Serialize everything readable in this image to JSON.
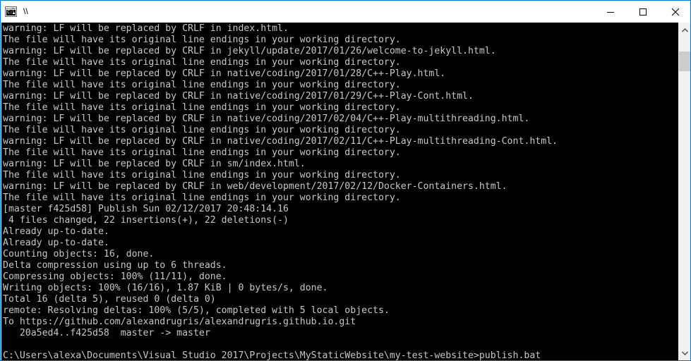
{
  "window": {
    "title": "\\\\",
    "icon": "cmd-console-icon",
    "icon_glyph": "C:\\",
    "accent_color": "#0078d7",
    "titlebar_background": "#ffffff",
    "console_background": "#000000",
    "console_foreground": "#c8c8c8"
  },
  "controls": {
    "minimize": "minimize-button",
    "maximize": "maximize-button",
    "close": "close-button"
  },
  "scrollbar": {
    "up_arrow": "scroll-up-arrow",
    "down_arrow": "scroll-down-arrow",
    "thumb": "scroll-thumb",
    "track_background": "#f0f0f0",
    "thumb_color": "#cdcdcd"
  },
  "console": {
    "lines": [
      "warning: LF will be replaced by CRLF in index.html.",
      "The file will have its original line endings in your working directory.",
      "warning: LF will be replaced by CRLF in jekyll/update/2017/01/26/welcome-to-jekyll.html.",
      "The file will have its original line endings in your working directory.",
      "warning: LF will be replaced by CRLF in native/coding/2017/01/28/C++-Play.html.",
      "The file will have its original line endings in your working directory.",
      "warning: LF will be replaced by CRLF in native/coding/2017/01/29/C++-Play-Cont.html.",
      "The file will have its original line endings in your working directory.",
      "warning: LF will be replaced by CRLF in native/coding/2017/02/04/C++-Play-multithreading.html.",
      "The file will have its original line endings in your working directory.",
      "warning: LF will be replaced by CRLF in native/coding/2017/02/11/C++-PLay-multithreading-Cont.html.",
      "The file will have its original line endings in your working directory.",
      "warning: LF will be replaced by CRLF in sm/index.html.",
      "The file will have its original line endings in your working directory.",
      "warning: LF will be replaced by CRLF in web/development/2017/02/12/Docker-Containers.html.",
      "The file will have its original line endings in your working directory.",
      "[master f425d58] Publish Sun 02/12/2017 20:48:14.16",
      " 4 files changed, 22 insertions(+), 22 deletions(-)",
      "Already up-to-date.",
      "Already up-to-date.",
      "Counting objects: 16, done.",
      "Delta compression using up to 6 threads.",
      "Compressing objects: 100% (11/11), done.",
      "Writing objects: 100% (16/16), 1.87 KiB | 0 bytes/s, done.",
      "Total 16 (delta 5), reused 0 (delta 0)",
      "remote: Resolving deltas: 100% (5/5), completed with 5 local objects.",
      "To https://github.com/alexandrugris/alexandrugris.github.io.git",
      "   20a5ed4..f425d58  master -> master",
      "",
      "C:\\Users\\alexa\\Documents\\Visual Studio 2017\\Projects\\MyStaticWebsite\\my-test-website>publish.bat"
    ],
    "prompt_path": "C:\\Users\\alexa\\Documents\\Visual Studio 2017\\Projects\\MyStaticWebsite\\my-test-website>",
    "prompt_command": "publish.bat",
    "commit_hash": "f425d58",
    "commit_branch": "master",
    "commit_message": "Publish Sun 02/12/2017 20:48:14.16",
    "files_changed": 4,
    "insertions": 22,
    "deletions": 22,
    "objects_counted": 16,
    "threads": 6,
    "compressed": "11/11",
    "written": "16/16",
    "written_size": "1.87 KiB",
    "written_speed": "0 bytes/s",
    "total_objects": 16,
    "delta": 5,
    "reused": 0,
    "remote_deltas": "5/5",
    "remote_url": "https://github.com/alexandrugris/alexandrugris.github.io.git",
    "ref_update_from": "20a5ed4",
    "ref_update_to": "f425d58"
  }
}
